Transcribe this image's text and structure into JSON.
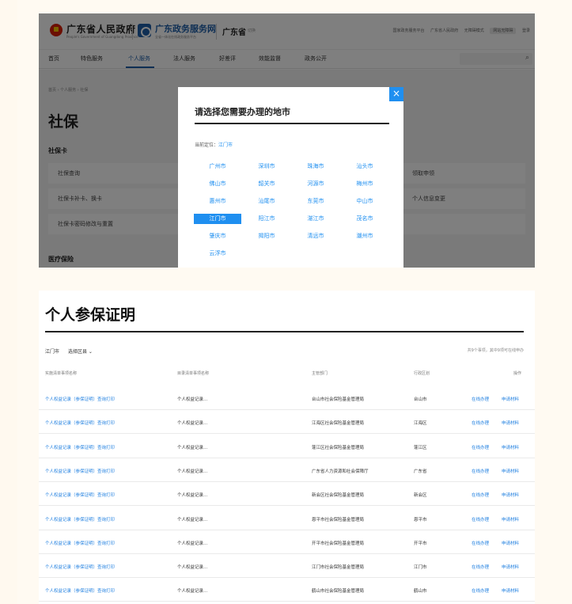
{
  "header": {
    "gov_title": "广东省人民政府",
    "gov_sub": "People's Government of Guangdong Province",
    "svc_title": "广东政务服务网",
    "svc_sub": "全省一体化在线政务服务平台",
    "province": "广东省",
    "province_switch": "切换",
    "links": [
      "国家政务服务平台",
      "广东省人民政府",
      "无障碍模式",
      "网站无障碍",
      "登录"
    ]
  },
  "nav": {
    "items": [
      "首页",
      "特色服务",
      "个人服务",
      "法人服务",
      "好差评",
      "效能监督",
      "政务公开"
    ],
    "active": "个人服务"
  },
  "background_page": {
    "breadcrumb": "首页 › 个人服务 › 社保",
    "heading": "社保",
    "section_card": "社保卡",
    "rows": [
      {
        "left": "社保查询",
        "right": "领取申领"
      },
      {
        "left": "社保卡补卡、换卡",
        "right": "个人信息变更"
      },
      {
        "left": "社保卡密码修改与重置",
        "right": ""
      }
    ],
    "section_medical": "医疗保险"
  },
  "modal": {
    "title": "请选择您需要办理的地市",
    "current_label": "当前定位：",
    "current_city": "江门市",
    "cities": [
      "广州市",
      "深圳市",
      "珠海市",
      "汕头市",
      "佛山市",
      "韶关市",
      "河源市",
      "梅州市",
      "惠州市",
      "汕尾市",
      "东莞市",
      "中山市",
      "江门市",
      "阳江市",
      "湛江市",
      "茂名市",
      "肇庆市",
      "揭阳市",
      "清远市",
      "潮州市",
      "云浮市"
    ],
    "selected": "江门市",
    "close": "×"
  },
  "list": {
    "title": "个人参保证明",
    "city": "江门市",
    "district_select": "选择区县",
    "count_note": "共9个事项，其中9项可在线申办",
    "columns": [
      "实施清单事项名称",
      "目录清单事项名称",
      "主管部门",
      "行政区划",
      "操作"
    ],
    "rows": [
      {
        "name": "个人权益记录（参保证明）查询打印",
        "catalog": "个人权益记录...",
        "dept": "台山市社会保险基金管理局",
        "region": "台山市",
        "op1": "在线办理",
        "op2": "申请材料"
      },
      {
        "name": "个人权益记录（参保证明）查询打印",
        "catalog": "个人权益记录...",
        "dept": "江海区社会保险基金管理局",
        "region": "江海区",
        "op1": "在线办理",
        "op2": "申请材料"
      },
      {
        "name": "个人权益记录（参保证明）查询打印",
        "catalog": "个人权益记录...",
        "dept": "蓬江区社会保险基金管理局",
        "region": "蓬江区",
        "op1": "在线办理",
        "op2": "申请材料"
      },
      {
        "name": "个人权益记录（参保证明）查询打印",
        "catalog": "个人权益记录...",
        "dept": "广东省人力资源和社会保障厅",
        "region": "广东省",
        "op1": "在线办理",
        "op2": "申请材料"
      },
      {
        "name": "个人权益记录（参保证明）查询打印",
        "catalog": "个人权益记录...",
        "dept": "新会区社会保险基金管理局",
        "region": "新会区",
        "op1": "在线办理",
        "op2": "申请材料"
      },
      {
        "name": "个人权益记录（参保证明）查询打印",
        "catalog": "个人权益记录...",
        "dept": "恩平市社会保险基金管理局",
        "region": "恩平市",
        "op1": "在线办理",
        "op2": "申请材料"
      },
      {
        "name": "个人权益记录（参保证明）查询打印",
        "catalog": "个人权益记录...",
        "dept": "开平市社会保险基金管理局",
        "region": "开平市",
        "op1": "在线办理",
        "op2": "申请材料"
      },
      {
        "name": "个人权益记录（参保证明）查询打印",
        "catalog": "个人权益记录...",
        "dept": "江门市社会保险基金管理局",
        "region": "江门市",
        "op1": "在线办理",
        "op2": "申请材料"
      },
      {
        "name": "个人权益记录（参保证明）查询打印",
        "catalog": "个人权益记录...",
        "dept": "鹤山市社会保险基金管理局",
        "region": "鹤山市",
        "op1": "在线办理",
        "op2": "申请材料"
      }
    ]
  }
}
